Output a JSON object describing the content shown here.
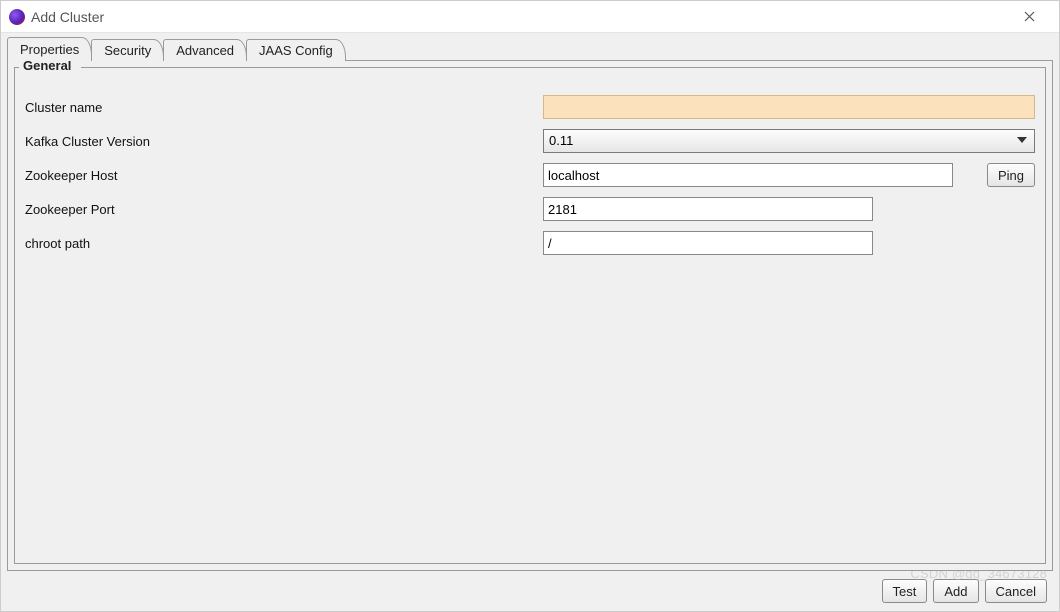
{
  "window": {
    "title": "Add Cluster"
  },
  "tabs": [
    {
      "label": "Properties"
    },
    {
      "label": "Security"
    },
    {
      "label": "Advanced"
    },
    {
      "label": "JAAS Config"
    }
  ],
  "group": {
    "legend": "General"
  },
  "fields": {
    "cluster_name": {
      "label": "Cluster name",
      "value": ""
    },
    "kafka_version": {
      "label": "Kafka Cluster Version",
      "value": "0.11"
    },
    "zk_host": {
      "label": "Zookeeper Host",
      "value": "localhost",
      "ping_label": "Ping"
    },
    "zk_port": {
      "label": "Zookeeper Port",
      "value": "2181"
    },
    "chroot": {
      "label": "chroot path",
      "value": "/"
    }
  },
  "buttons": {
    "test": "Test",
    "add": "Add",
    "cancel": "Cancel"
  },
  "watermark": "CSDN @qq_34673128"
}
